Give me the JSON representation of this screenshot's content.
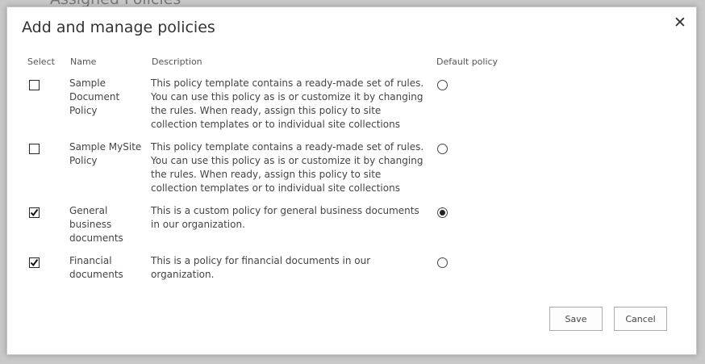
{
  "background": {
    "partial_title": "Assigned Policies"
  },
  "dialog": {
    "title": "Add and manage policies",
    "close_label": "✕"
  },
  "columns": {
    "select": "Select",
    "name": "Name",
    "description": "Description",
    "default_policy": "Default policy"
  },
  "policies": [
    {
      "checked": false,
      "name": "Sample Document Policy",
      "description": "This policy template contains a ready-made set of rules. You can use this policy as is or customize it by changing the rules. When ready, assign this policy to site collection templates or to individual site collections",
      "is_default": false
    },
    {
      "checked": false,
      "name": "Sample MySite Policy",
      "description": "This policy template contains a ready-made set of rules. You can use this policy as is or customize it by changing the rules. When ready, assign this policy to site collection templates or to individual site collections",
      "is_default": false
    },
    {
      "checked": true,
      "name": "General business documents",
      "description": "This is a custom policy for general business documents in our organization.",
      "is_default": true
    },
    {
      "checked": true,
      "name": "Financial documents",
      "description": "This is a policy for financial documents in our organization.",
      "is_default": false
    }
  ],
  "buttons": {
    "save": "Save",
    "cancel": "Cancel"
  }
}
